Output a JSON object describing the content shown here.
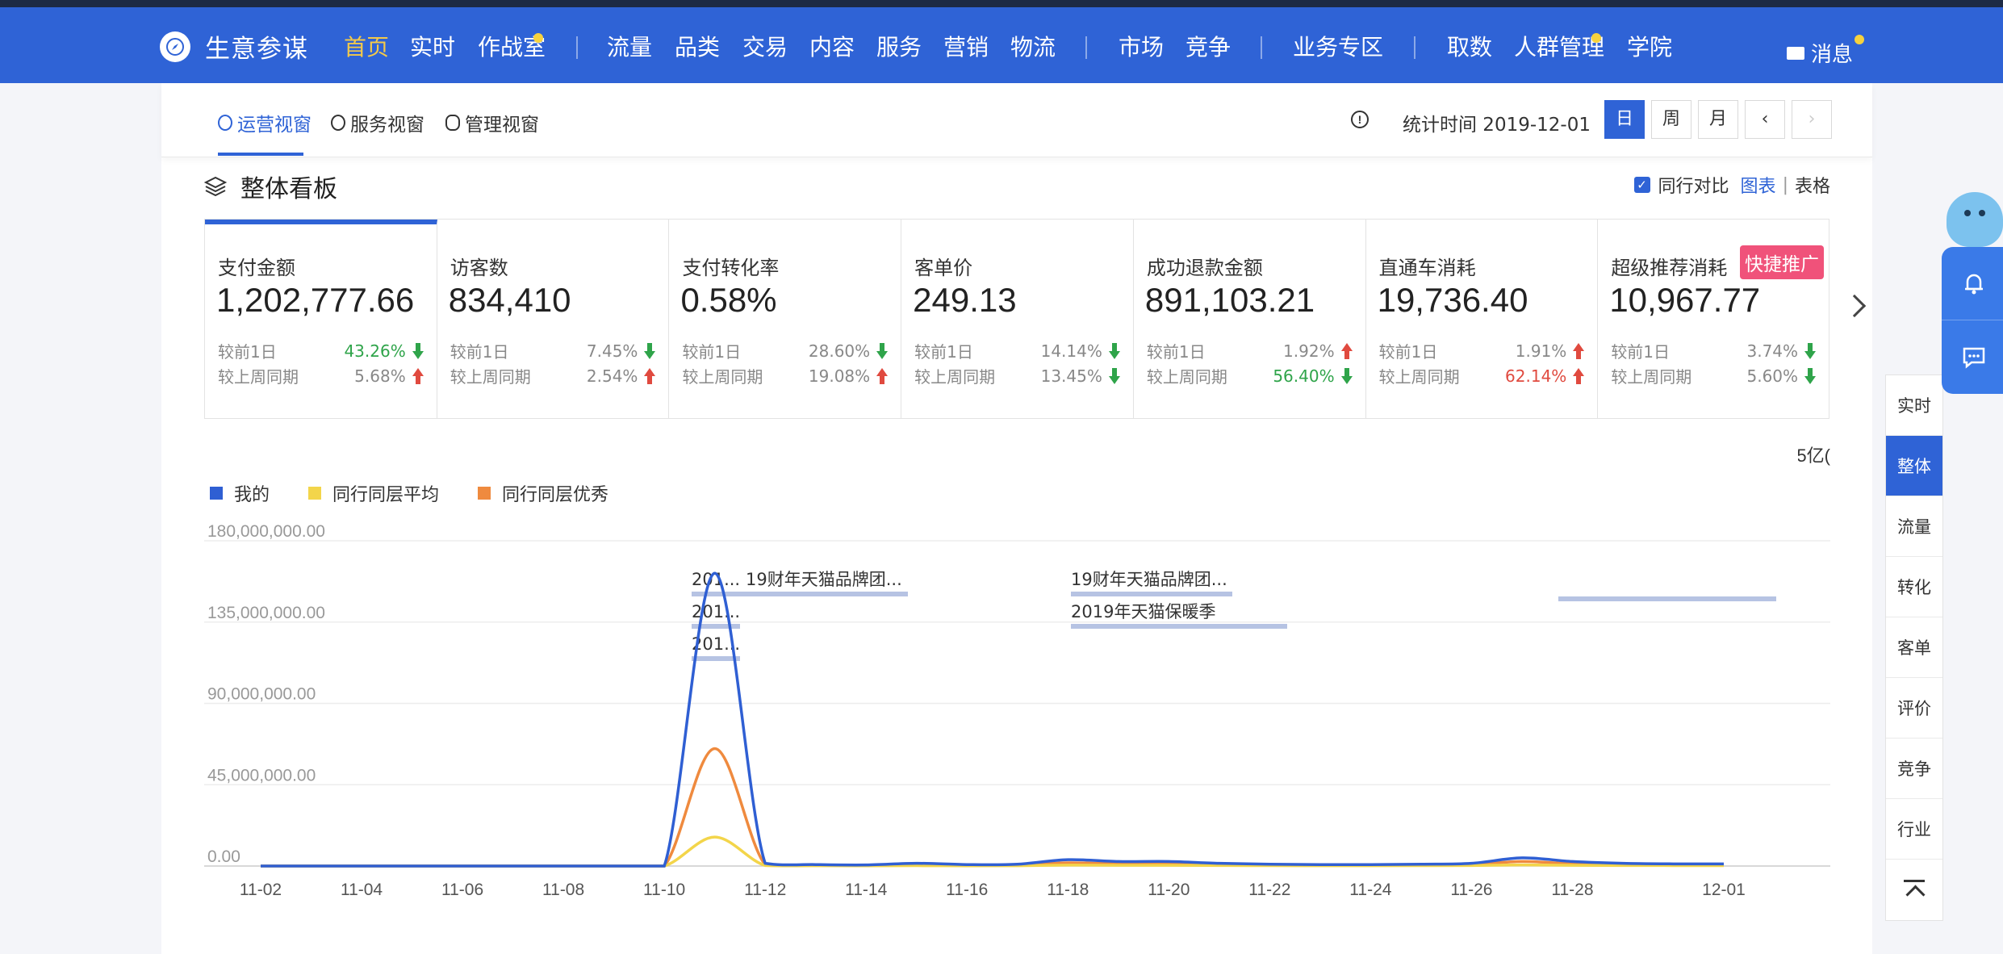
{
  "app": {
    "name": "生意参谋"
  },
  "nav": {
    "items": [
      {
        "label": "首页",
        "active": true
      },
      {
        "label": "实时"
      },
      {
        "label": "作战室",
        "dot": true
      },
      {
        "label": "流量"
      },
      {
        "label": "品类"
      },
      {
        "label": "交易"
      },
      {
        "label": "内容"
      },
      {
        "label": "服务"
      },
      {
        "label": "营销"
      },
      {
        "label": "物流"
      },
      {
        "label": "市场"
      },
      {
        "label": "竞争"
      },
      {
        "label": "业务专区"
      },
      {
        "label": "取数"
      },
      {
        "label": "人群管理",
        "dot": true
      },
      {
        "label": "学院"
      }
    ],
    "message": "消息"
  },
  "subnav": {
    "tabs": [
      {
        "label": "运营视窗",
        "active": true
      },
      {
        "label": "服务视窗"
      },
      {
        "label": "管理视窗"
      }
    ],
    "stat_time": "统计时间 2019-12-01",
    "date_buttons": [
      "日",
      "周",
      "月"
    ]
  },
  "board": {
    "title": "整体看板",
    "compare_label": "同行对比",
    "view_chart": "图表",
    "view_table": "表格",
    "truncated_unit": ")5亿"
  },
  "metrics": [
    {
      "label": "支付金额",
      "value": "1,202,777.66",
      "d1_label": "较前1日",
      "d1": "43.26%",
      "d1_dir": "down",
      "d1_color": "green",
      "w_label": "较上周同期",
      "w": "5.68%",
      "w_dir": "up",
      "w_color": ""
    },
    {
      "label": "访客数",
      "value": "834,410",
      "d1_label": "较前1日",
      "d1": "7.45%",
      "d1_dir": "down",
      "d1_color": "",
      "w_label": "较上周同期",
      "w": "2.54%",
      "w_dir": "up",
      "w_color": ""
    },
    {
      "label": "支付转化率",
      "value": "0.58%",
      "d1_label": "较前1日",
      "d1": "28.60%",
      "d1_dir": "down",
      "d1_color": "",
      "w_label": "较上周同期",
      "w": "19.08%",
      "w_dir": "up",
      "w_color": ""
    },
    {
      "label": "客单价",
      "value": "249.13",
      "d1_label": "较前1日",
      "d1": "14.14%",
      "d1_dir": "down",
      "d1_color": "",
      "w_label": "较上周同期",
      "w": "13.45%",
      "w_dir": "down",
      "w_color": ""
    },
    {
      "label": "成功退款金额",
      "value": "891,103.21",
      "d1_label": "较前1日",
      "d1": "1.92%",
      "d1_dir": "up",
      "d1_color": "",
      "w_label": "较上周同期",
      "w": "56.40%",
      "w_dir": "down",
      "w_color": "green"
    },
    {
      "label": "直通车消耗",
      "value": "19,736.40",
      "d1_label": "较前1日",
      "d1": "1.91%",
      "d1_dir": "up",
      "d1_color": "",
      "w_label": "较上周同期",
      "w": "62.14%",
      "w_dir": "up",
      "w_color": "red"
    },
    {
      "label": "超级推荐消耗",
      "value": "10,967.77",
      "badge": "快捷推广",
      "d1_label": "较前1日",
      "d1": "3.74%",
      "d1_dir": "down",
      "d1_color": "",
      "w_label": "较上周同期",
      "w": "5.60%",
      "w_dir": "down",
      "w_color": ""
    }
  ],
  "sidebar": [
    "实时",
    "整体",
    "流量",
    "转化",
    "客单",
    "评价",
    "竞争",
    "行业"
  ],
  "chart_data": {
    "type": "line",
    "x": [
      "11-02",
      "11-03",
      "11-04",
      "11-05",
      "11-06",
      "11-07",
      "11-08",
      "11-09",
      "11-10",
      "11-11",
      "11-12",
      "11-13",
      "11-14",
      "11-15",
      "11-16",
      "11-17",
      "11-18",
      "11-19",
      "11-20",
      "11-21",
      "11-22",
      "11-23",
      "11-24",
      "11-25",
      "11-26",
      "11-27",
      "11-28",
      "11-29",
      "11-30",
      "12-01"
    ],
    "x_ticks": [
      "11-02",
      "11-04",
      "11-06",
      "11-08",
      "11-10",
      "11-12",
      "11-14",
      "11-16",
      "11-18",
      "11-20",
      "11-22",
      "11-24",
      "11-26",
      "11-28",
      "12-01"
    ],
    "y_ticks": [
      "180,000,000.00",
      "135,000,000.00",
      "90,000,000.00",
      "45,000,000.00",
      "0.00"
    ],
    "ylim": [
      0,
      180000000
    ],
    "series": [
      {
        "name": "我的",
        "color": "#2f5fd3",
        "values": [
          0,
          0,
          0,
          0,
          0,
          0,
          0,
          0,
          0,
          162000000,
          1500000,
          800000,
          600000,
          1500000,
          800000,
          1000000,
          3500000,
          2500000,
          2500000,
          1500000,
          1000000,
          800000,
          800000,
          1000000,
          1500000,
          4500000,
          2500000,
          1500000,
          1200000,
          1200000
        ]
      },
      {
        "name": "同行同层平均",
        "color": "#f3d54a",
        "values": [
          0,
          0,
          0,
          0,
          0,
          0,
          0,
          0,
          0,
          16000000,
          300000,
          150000,
          100000,
          200000,
          100000,
          150000,
          500000,
          400000,
          400000,
          300000,
          200000,
          150000,
          150000,
          200000,
          300000,
          600000,
          400000,
          300000,
          250000,
          250000
        ]
      },
      {
        "name": "同行同层优秀",
        "color": "#ef8a3e",
        "values": [
          0,
          0,
          0,
          0,
          0,
          0,
          0,
          0,
          0,
          65000000,
          800000,
          400000,
          300000,
          700000,
          400000,
          500000,
          1800000,
          1200000,
          1200000,
          800000,
          500000,
          400000,
          400000,
          500000,
          800000,
          2500000,
          1300000,
          800000,
          600000,
          600000
        ]
      }
    ],
    "annotations": [
      {
        "text": "201...",
        "x": "11-10"
      },
      {
        "text": "19财年天猫品牌团...",
        "x": "11-10"
      },
      {
        "text": "201...",
        "x": "11-10"
      },
      {
        "text": "201...",
        "x": "11-10"
      },
      {
        "text": "19财年天猫品牌团...",
        "x": "11-17"
      },
      {
        "text": "2019年天猫保暖季",
        "x": "11-17"
      },
      {
        "text": "",
        "x": "11-27"
      }
    ]
  }
}
